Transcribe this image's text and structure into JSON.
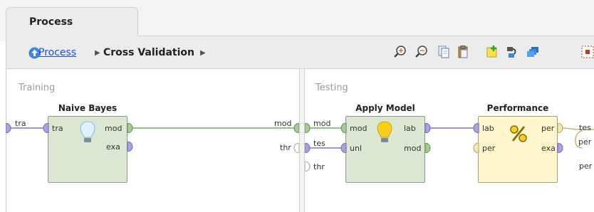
{
  "tab": {
    "label": "Process"
  },
  "breadcrumb": {
    "root": "Process",
    "current": "Cross Validation"
  },
  "toolbar": {
    "icons": [
      "zoom-in-icon",
      "zoom-out-icon",
      "copy-icon",
      "paste-icon",
      "add-note-icon",
      "auto-wire-icon",
      "arrange-icon",
      "fit-view-icon"
    ]
  },
  "training": {
    "title": "Training",
    "inner_input": "tra",
    "inner_output": "mod",
    "operator": {
      "name": "Naive Bayes",
      "in_ports": [
        "tra"
      ],
      "out_ports": [
        "mod",
        "exa"
      ]
    }
  },
  "testing": {
    "title": "Testing",
    "inner_inputs": [
      "mod",
      "tes",
      "thr"
    ],
    "left_inputs": [
      "mod",
      "thr"
    ],
    "apply_model": {
      "name": "Apply Model",
      "in_ports": [
        "mod",
        "unl"
      ],
      "out_ports": [
        "lab",
        "mod"
      ]
    },
    "performance": {
      "name": "Performance",
      "in_ports": [
        "lab",
        "per"
      ],
      "out_ports": [
        "per",
        "exa"
      ]
    },
    "outputs": [
      "tes",
      "per",
      "per"
    ]
  },
  "colors": {
    "example_port": "#a7a4de",
    "model_port": "#a8c99a",
    "performance_port": "#f4e9b0",
    "wire_example": "#7a74d8",
    "wire_model": "#6fae5f",
    "wire_performance": "#c2b56f"
  }
}
